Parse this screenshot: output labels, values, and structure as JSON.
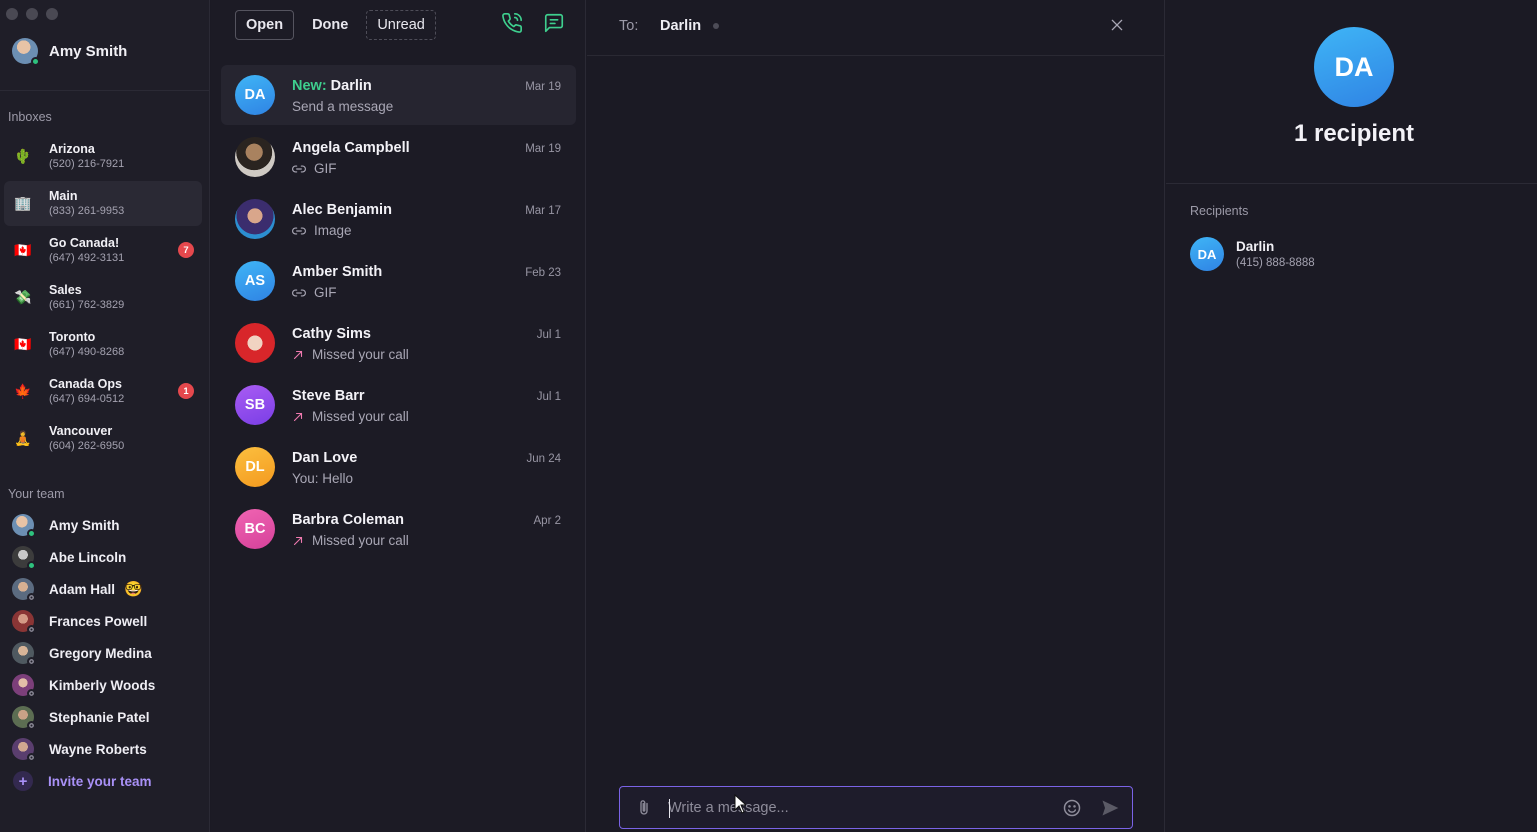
{
  "user": {
    "name": "Amy Smith"
  },
  "sidebar": {
    "inboxes_label": "Inboxes",
    "inboxes": [
      {
        "name": "Arizona",
        "phone": "(520) 216-7921",
        "emoji": "🌵",
        "badge": null
      },
      {
        "name": "Main",
        "phone": "(833) 261-9953",
        "emoji": "🏢",
        "badge": null
      },
      {
        "name": "Go Canada!",
        "phone": "(647) 492-3131",
        "emoji": "🇨🇦",
        "badge": "7"
      },
      {
        "name": "Sales",
        "phone": "(661) 762-3829",
        "emoji": "💸",
        "badge": null
      },
      {
        "name": "Toronto",
        "phone": "(647) 490-8268",
        "emoji": "🇨🇦",
        "badge": null
      },
      {
        "name": "Canada Ops",
        "phone": "(647) 694-0512",
        "emoji": "🍁",
        "badge": "1"
      },
      {
        "name": "Vancouver",
        "phone": "(604) 262-6950",
        "emoji": "🧘",
        "badge": null
      }
    ],
    "team_label": "Your team",
    "team": [
      {
        "name": "Amy Smith",
        "status": "online"
      },
      {
        "name": "Abe Lincoln",
        "status": "online"
      },
      {
        "name": "Adam Hall",
        "status": "away",
        "emoji": "🤓"
      },
      {
        "name": "Frances Powell",
        "status": "away"
      },
      {
        "name": "Gregory Medina",
        "status": "away"
      },
      {
        "name": "Kimberly Woods",
        "status": "away"
      },
      {
        "name": "Stephanie Patel",
        "status": "away"
      },
      {
        "name": "Wayne Roberts",
        "status": "away"
      }
    ],
    "invite_label": "Invite your team"
  },
  "filters": {
    "open": "Open",
    "done": "Done",
    "unread": "Unread"
  },
  "conversations": [
    {
      "initials": "DA",
      "prefix": "New:",
      "name": "Darlin",
      "preview": "Send a message",
      "icon": null,
      "date": "Mar 19"
    },
    {
      "initials": "",
      "prefix": "",
      "name": "Angela Campbell",
      "preview": "GIF",
      "icon": "attachment-icon",
      "date": "Mar 19"
    },
    {
      "initials": "",
      "prefix": "",
      "name": "Alec Benjamin",
      "preview": "Image",
      "icon": "attachment-icon",
      "date": "Mar 17"
    },
    {
      "initials": "AS",
      "prefix": "",
      "name": "Amber Smith",
      "preview": "GIF",
      "icon": "attachment-icon",
      "date": "Feb 23"
    },
    {
      "initials": "",
      "prefix": "",
      "name": "Cathy Sims",
      "preview": "Missed your call",
      "icon": "missed-call-icon",
      "date": "Jul 1"
    },
    {
      "initials": "SB",
      "prefix": "",
      "name": "Steve Barr",
      "preview": "Missed your call",
      "icon": "missed-call-icon",
      "date": "Jul 1"
    },
    {
      "initials": "DL",
      "prefix": "",
      "name": "Dan Love",
      "preview": "You: Hello",
      "icon": null,
      "date": "Jun 24"
    },
    {
      "initials": "BC",
      "prefix": "",
      "name": "Barbra Coleman",
      "preview": "Missed your call",
      "icon": "missed-call-icon",
      "date": "Apr 2"
    }
  ],
  "chat": {
    "to_label": "To:",
    "to_name": "Darlin",
    "composer_placeholder": "Write a message..."
  },
  "details": {
    "initials": "DA",
    "recipient_count": "1 recipient",
    "recipients_label": "Recipients",
    "recipients": [
      {
        "initials": "DA",
        "name": "Darlin",
        "phone": "(415) 888-8888"
      }
    ]
  },
  "colors": {
    "accent": "#7a63e6",
    "new_label": "#3ecf8e",
    "badge": "#e5484d",
    "call_icon": "#3ecf8e"
  }
}
